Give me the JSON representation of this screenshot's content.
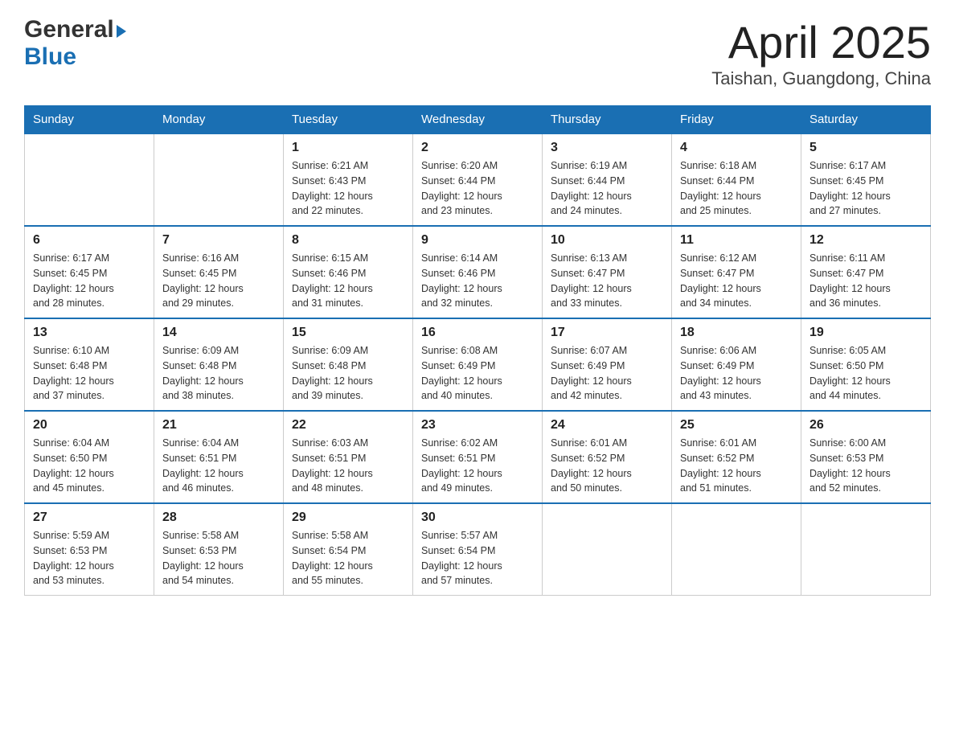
{
  "header": {
    "logo_general": "General",
    "logo_blue": "Blue",
    "title": "April 2025",
    "subtitle": "Taishan, Guangdong, China"
  },
  "days_of_week": [
    "Sunday",
    "Monday",
    "Tuesday",
    "Wednesday",
    "Thursday",
    "Friday",
    "Saturday"
  ],
  "weeks": [
    [
      {
        "day": "",
        "info": ""
      },
      {
        "day": "",
        "info": ""
      },
      {
        "day": "1",
        "info": "Sunrise: 6:21 AM\nSunset: 6:43 PM\nDaylight: 12 hours\nand 22 minutes."
      },
      {
        "day": "2",
        "info": "Sunrise: 6:20 AM\nSunset: 6:44 PM\nDaylight: 12 hours\nand 23 minutes."
      },
      {
        "day": "3",
        "info": "Sunrise: 6:19 AM\nSunset: 6:44 PM\nDaylight: 12 hours\nand 24 minutes."
      },
      {
        "day": "4",
        "info": "Sunrise: 6:18 AM\nSunset: 6:44 PM\nDaylight: 12 hours\nand 25 minutes."
      },
      {
        "day": "5",
        "info": "Sunrise: 6:17 AM\nSunset: 6:45 PM\nDaylight: 12 hours\nand 27 minutes."
      }
    ],
    [
      {
        "day": "6",
        "info": "Sunrise: 6:17 AM\nSunset: 6:45 PM\nDaylight: 12 hours\nand 28 minutes."
      },
      {
        "day": "7",
        "info": "Sunrise: 6:16 AM\nSunset: 6:45 PM\nDaylight: 12 hours\nand 29 minutes."
      },
      {
        "day": "8",
        "info": "Sunrise: 6:15 AM\nSunset: 6:46 PM\nDaylight: 12 hours\nand 31 minutes."
      },
      {
        "day": "9",
        "info": "Sunrise: 6:14 AM\nSunset: 6:46 PM\nDaylight: 12 hours\nand 32 minutes."
      },
      {
        "day": "10",
        "info": "Sunrise: 6:13 AM\nSunset: 6:47 PM\nDaylight: 12 hours\nand 33 minutes."
      },
      {
        "day": "11",
        "info": "Sunrise: 6:12 AM\nSunset: 6:47 PM\nDaylight: 12 hours\nand 34 minutes."
      },
      {
        "day": "12",
        "info": "Sunrise: 6:11 AM\nSunset: 6:47 PM\nDaylight: 12 hours\nand 36 minutes."
      }
    ],
    [
      {
        "day": "13",
        "info": "Sunrise: 6:10 AM\nSunset: 6:48 PM\nDaylight: 12 hours\nand 37 minutes."
      },
      {
        "day": "14",
        "info": "Sunrise: 6:09 AM\nSunset: 6:48 PM\nDaylight: 12 hours\nand 38 minutes."
      },
      {
        "day": "15",
        "info": "Sunrise: 6:09 AM\nSunset: 6:48 PM\nDaylight: 12 hours\nand 39 minutes."
      },
      {
        "day": "16",
        "info": "Sunrise: 6:08 AM\nSunset: 6:49 PM\nDaylight: 12 hours\nand 40 minutes."
      },
      {
        "day": "17",
        "info": "Sunrise: 6:07 AM\nSunset: 6:49 PM\nDaylight: 12 hours\nand 42 minutes."
      },
      {
        "day": "18",
        "info": "Sunrise: 6:06 AM\nSunset: 6:49 PM\nDaylight: 12 hours\nand 43 minutes."
      },
      {
        "day": "19",
        "info": "Sunrise: 6:05 AM\nSunset: 6:50 PM\nDaylight: 12 hours\nand 44 minutes."
      }
    ],
    [
      {
        "day": "20",
        "info": "Sunrise: 6:04 AM\nSunset: 6:50 PM\nDaylight: 12 hours\nand 45 minutes."
      },
      {
        "day": "21",
        "info": "Sunrise: 6:04 AM\nSunset: 6:51 PM\nDaylight: 12 hours\nand 46 minutes."
      },
      {
        "day": "22",
        "info": "Sunrise: 6:03 AM\nSunset: 6:51 PM\nDaylight: 12 hours\nand 48 minutes."
      },
      {
        "day": "23",
        "info": "Sunrise: 6:02 AM\nSunset: 6:51 PM\nDaylight: 12 hours\nand 49 minutes."
      },
      {
        "day": "24",
        "info": "Sunrise: 6:01 AM\nSunset: 6:52 PM\nDaylight: 12 hours\nand 50 minutes."
      },
      {
        "day": "25",
        "info": "Sunrise: 6:01 AM\nSunset: 6:52 PM\nDaylight: 12 hours\nand 51 minutes."
      },
      {
        "day": "26",
        "info": "Sunrise: 6:00 AM\nSunset: 6:53 PM\nDaylight: 12 hours\nand 52 minutes."
      }
    ],
    [
      {
        "day": "27",
        "info": "Sunrise: 5:59 AM\nSunset: 6:53 PM\nDaylight: 12 hours\nand 53 minutes."
      },
      {
        "day": "28",
        "info": "Sunrise: 5:58 AM\nSunset: 6:53 PM\nDaylight: 12 hours\nand 54 minutes."
      },
      {
        "day": "29",
        "info": "Sunrise: 5:58 AM\nSunset: 6:54 PM\nDaylight: 12 hours\nand 55 minutes."
      },
      {
        "day": "30",
        "info": "Sunrise: 5:57 AM\nSunset: 6:54 PM\nDaylight: 12 hours\nand 57 minutes."
      },
      {
        "day": "",
        "info": ""
      },
      {
        "day": "",
        "info": ""
      },
      {
        "day": "",
        "info": ""
      }
    ]
  ]
}
